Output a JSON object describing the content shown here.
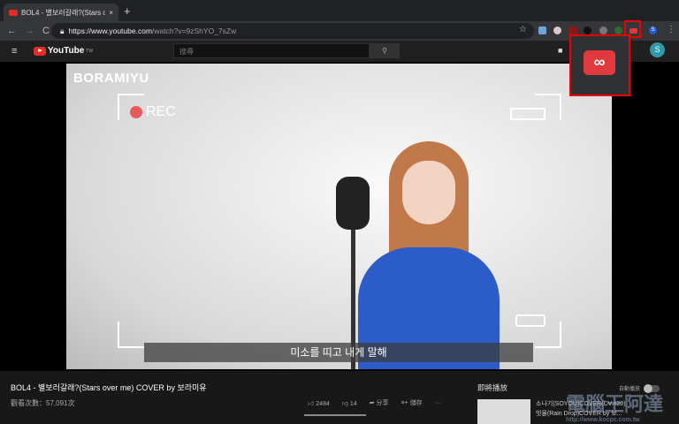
{
  "browser": {
    "tab_title": "BOL4 - 별보러갈래?(Stars over me)",
    "new_tab": "+",
    "close": "×",
    "url_host": "https://www.youtube.com",
    "url_path": "/watch?v=9zShYO_7sZw",
    "back": "←",
    "forward": "→",
    "reload": "C",
    "star": "☆",
    "profile": "S",
    "menu": "⋮"
  },
  "extension_popup": {
    "icon": "∞",
    "accent": "#e0393e"
  },
  "youtube": {
    "logo": "YouTube",
    "region": "TW",
    "search_placeholder": "搜尋",
    "search_icon": "⚲",
    "avatar": "S",
    "menu_icon": "≡"
  },
  "video": {
    "brand": "BORAMIYU",
    "rec": "REC",
    "subtitle": "미소를 띠고 내게 말해"
  },
  "info": {
    "title": "BOL4 - 별보러갈래?(Stars over me) COVER by 보라미유",
    "views": "觀看次數：57,091次",
    "likes": "2484",
    "dislikes": "14",
    "share": "分享",
    "save": "儲存",
    "more": "···"
  },
  "sidebar": {
    "up_next": "即將播放",
    "autoplay": "自動播放",
    "next_title_1": "소나기(SOYOU)COVER(CV.420)",
    "next_title_2": "빗물(Rain Drop)COVER by 보..."
  },
  "watermark": {
    "text": "電腦王阿達",
    "url": "http://www.kocpc.com.tw"
  }
}
